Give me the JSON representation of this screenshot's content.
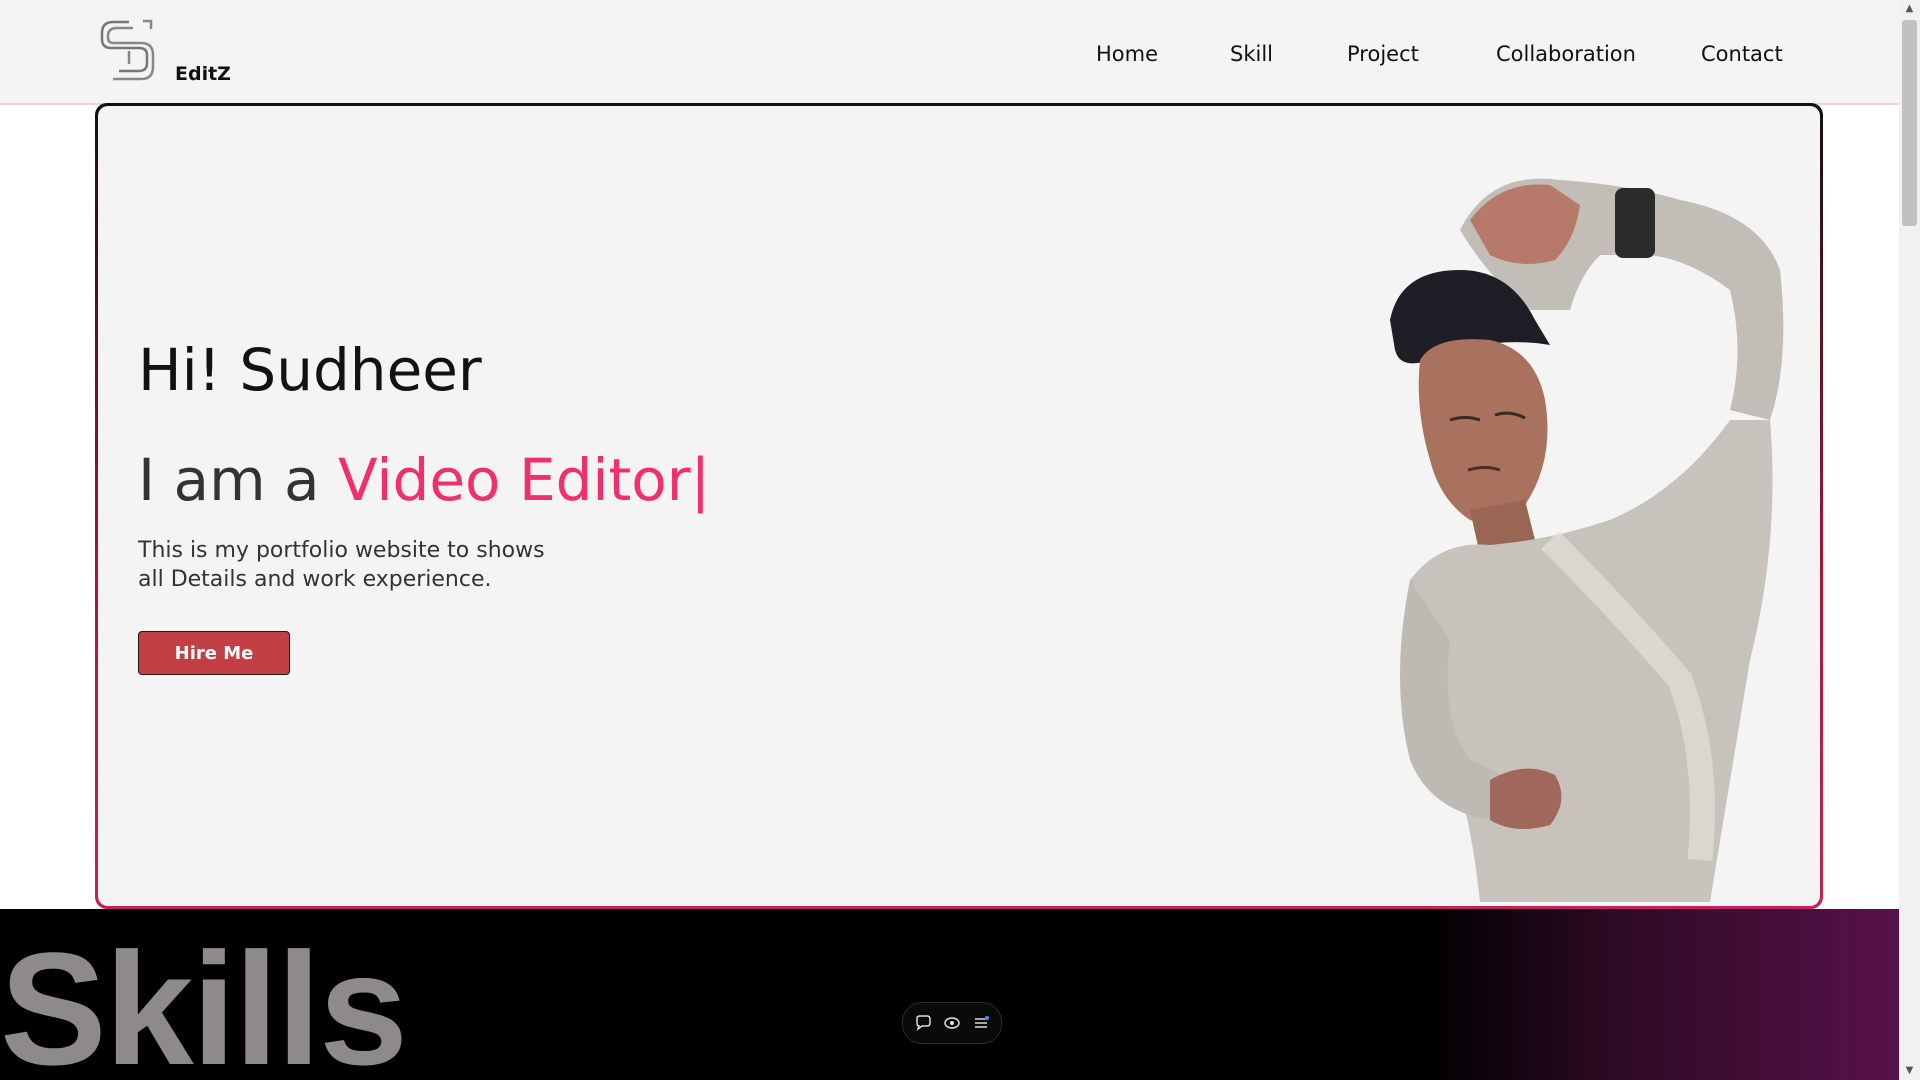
{
  "header": {
    "brand": "EditZ",
    "nav": [
      {
        "label": "Home"
      },
      {
        "label": "Skill"
      },
      {
        "label": "Project"
      },
      {
        "label": "Collaboration"
      },
      {
        "label": "Contact"
      }
    ]
  },
  "hero": {
    "greeting": "Hi! Sudheer",
    "role_prefix": "I am a ",
    "role_accent": "Video Editor",
    "caret": "|",
    "description": "This is my portfolio website to shows all Details and work experience.",
    "cta_label": "Hire Me"
  },
  "skills": {
    "title": "Skills"
  },
  "toolbar": {
    "icons": [
      "comment-icon",
      "eye-icon",
      "menu-icon"
    ]
  },
  "colors": {
    "accent": "#f1306b",
    "button": "#c13f45",
    "header_bg": "#f4f4f4",
    "skills_gradient_end": "#571149"
  }
}
